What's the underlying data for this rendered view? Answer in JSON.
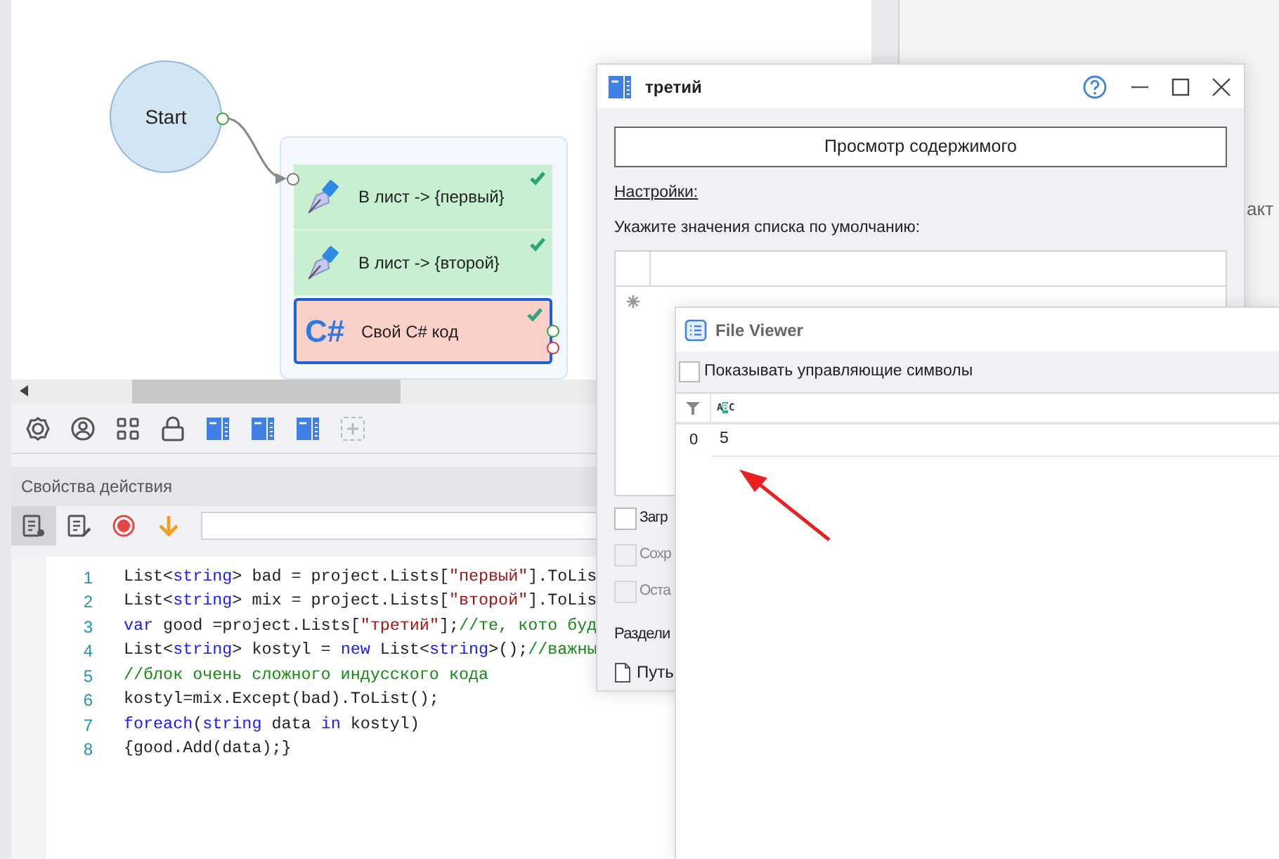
{
  "canvas": {
    "start_node": {
      "label": "Start"
    },
    "nodes": [
      {
        "label": "В лист -> {первый}",
        "kind": "list",
        "valid": true,
        "selected": false
      },
      {
        "label": "В лист -> {второй}",
        "kind": "list",
        "valid": true,
        "selected": false
      },
      {
        "label": "Свой C# код",
        "kind": "code",
        "icon_label": "C#",
        "valid": true,
        "selected": true
      }
    ]
  },
  "properties_panel": {
    "title": "Свойства действия",
    "tabs": [
      {
        "selected": true
      },
      {
        "selected": false
      }
    ]
  },
  "code_editor": {
    "lines": [
      {
        "number": "1",
        "tokens": [
          {
            "kind": "plain",
            "text": "List<"
          },
          {
            "kind": "keyword",
            "text": "string"
          },
          {
            "kind": "plain",
            "text": "> bad = project.Lists["
          },
          {
            "kind": "string",
            "text": "\"первый\""
          },
          {
            "kind": "plain",
            "text": "].ToLis"
          }
        ]
      },
      {
        "number": "2",
        "tokens": [
          {
            "kind": "plain",
            "text": "List<"
          },
          {
            "kind": "keyword",
            "text": "string"
          },
          {
            "kind": "plain",
            "text": "> mix = project.Lists["
          },
          {
            "kind": "string",
            "text": "\"второй\""
          },
          {
            "kind": "plain",
            "text": "].ToLis"
          }
        ]
      },
      {
        "number": "3",
        "tokens": [
          {
            "kind": "keyword",
            "text": "var"
          },
          {
            "kind": "plain",
            "text": " good =project.Lists["
          },
          {
            "kind": "string",
            "text": "\"третий\""
          },
          {
            "kind": "plain",
            "text": "];"
          },
          {
            "kind": "comment",
            "text": "//те, кото буд"
          }
        ]
      },
      {
        "number": "4",
        "tokens": [
          {
            "kind": "plain",
            "text": "List<"
          },
          {
            "kind": "keyword",
            "text": "string"
          },
          {
            "kind": "plain",
            "text": "> kostyl = "
          },
          {
            "kind": "keyword",
            "text": "new"
          },
          {
            "kind": "plain",
            "text": " List<"
          },
          {
            "kind": "keyword",
            "text": "string"
          },
          {
            "kind": "plain",
            "text": ">();"
          },
          {
            "kind": "comment",
            "text": "//важны"
          }
        ]
      },
      {
        "number": "5",
        "tokens": [
          {
            "kind": "comment",
            "text": "//блок очень сложного индусского кода"
          }
        ]
      },
      {
        "number": "6",
        "tokens": [
          {
            "kind": "plain",
            "text": "kostyl=mix.Except(bad).ToList();"
          }
        ]
      },
      {
        "number": "7",
        "tokens": [
          {
            "kind": "keyword",
            "text": "foreach"
          },
          {
            "kind": "plain",
            "text": "("
          },
          {
            "kind": "keyword",
            "text": "string"
          },
          {
            "kind": "plain",
            "text": " data "
          },
          {
            "kind": "keyword",
            "text": "in"
          },
          {
            "kind": "plain",
            "text": " kostyl)"
          }
        ]
      },
      {
        "number": "8",
        "tokens": [
          {
            "kind": "plain",
            "text": "{good.Add(data);}"
          }
        ]
      }
    ]
  },
  "background_text": "акт",
  "list_window": {
    "title": "третий",
    "view_button": "Просмотр содержимого",
    "settings_link": "Настройки:",
    "defaults_label": "Укажите значения списка по умолчанию:",
    "options": [
      {
        "label": "Загр",
        "checked": false,
        "disabled": false
      },
      {
        "label": "Сохр",
        "checked": false,
        "disabled": true
      },
      {
        "label": "Оста",
        "checked": false,
        "disabled": true
      }
    ],
    "separator_label": "Раздели",
    "path_label": "Путь"
  },
  "file_viewer": {
    "title": "File Viewer",
    "show_control_chars": {
      "label": "Показывать управляющие символы",
      "checked": false
    },
    "column_type": "ABC",
    "rows": [
      {
        "index": "0",
        "value": "5"
      }
    ]
  }
}
